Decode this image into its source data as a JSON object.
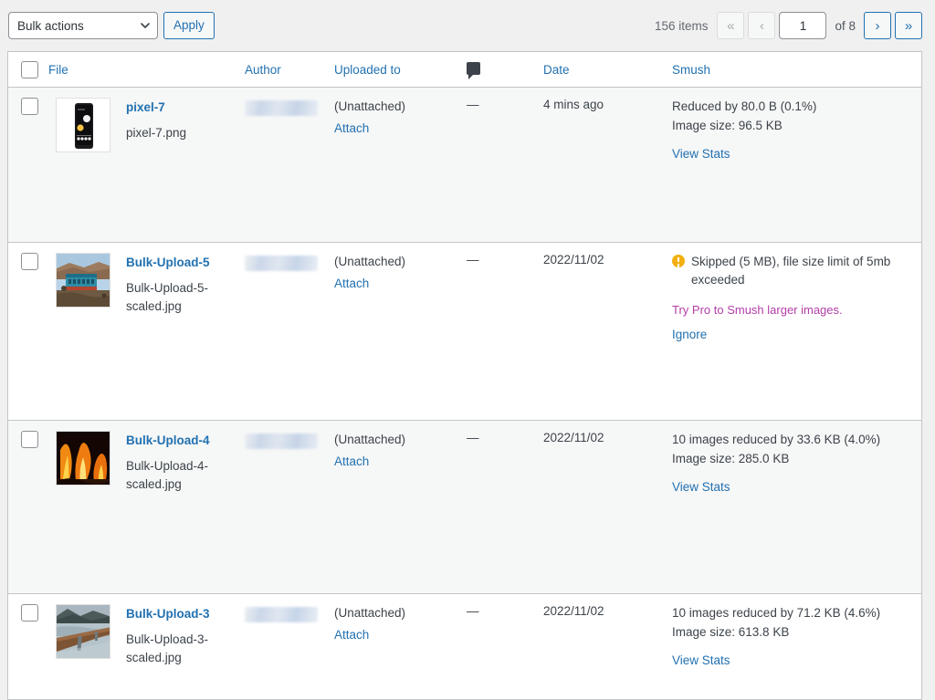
{
  "toolbar": {
    "bulk_actions_label": "Bulk actions",
    "apply_label": "Apply",
    "chevron_icon": "chevron-down-icon"
  },
  "pagination": {
    "items_count": "156 items",
    "first_label": "«",
    "prev_label": "‹",
    "current_page": "1",
    "of_label": "of 8",
    "next_label": "›",
    "last_label": "»"
  },
  "table": {
    "headers": {
      "file": "File",
      "author": "Author",
      "uploaded_to": "Uploaded to",
      "comments": "comment-bubble-icon",
      "date": "Date",
      "smush": "Smush"
    },
    "rows": [
      {
        "title": "pixel-7",
        "filename": "pixel-7.png",
        "thumb": "phone-thumbnail",
        "author": "redacted",
        "uploaded_to": "(Unattached)",
        "attach_label": "Attach",
        "comments": "—",
        "date": "4 mins ago",
        "smush": {
          "status": "smushed",
          "line1": "Reduced by 80.0 B (0.1%)",
          "line2": "Image size: 96.5 KB",
          "action": "View Stats"
        }
      },
      {
        "title": "Bulk-Upload-5",
        "filename": "Bulk-Upload-5-scaled.jpg",
        "thumb": "desert-building-thumbnail",
        "author": "redacted",
        "uploaded_to": "(Unattached)",
        "attach_label": "Attach",
        "comments": "—",
        "date": "2022/11/02",
        "smush": {
          "status": "skipped",
          "skipped_text": "Skipped (5 MB), file size limit of 5mb exceeded",
          "pro_link": "Try Pro to Smush larger images.",
          "action": "Ignore"
        }
      },
      {
        "title": "Bulk-Upload-4",
        "filename": "Bulk-Upload-4-scaled.jpg",
        "thumb": "fire-thumbnail",
        "author": "redacted",
        "uploaded_to": "(Unattached)",
        "attach_label": "Attach",
        "comments": "—",
        "date": "2022/11/02",
        "smush": {
          "status": "smushed",
          "line1": "10 images reduced by 33.6 KB (4.0%)",
          "line2": "Image size: 285.0 KB",
          "action": "View Stats"
        }
      },
      {
        "title": "Bulk-Upload-3",
        "filename": "Bulk-Upload-3-scaled.jpg",
        "thumb": "pier-lake-thumbnail",
        "author": "redacted",
        "uploaded_to": "(Unattached)",
        "attach_label": "Attach",
        "comments": "—",
        "date": "2022/11/02",
        "smush": {
          "status": "smushed",
          "line1": "10 images reduced by 71.2 KB (4.6%)",
          "line2": "Image size: 613.8 KB",
          "action": "View Stats"
        }
      }
    ]
  },
  "colors": {
    "link": "#2271b1",
    "pro_link": "#b33ea8",
    "warning": "#f2b00e",
    "page_bg": "#f0f0f1",
    "row_alt": "#f6f7f7"
  }
}
